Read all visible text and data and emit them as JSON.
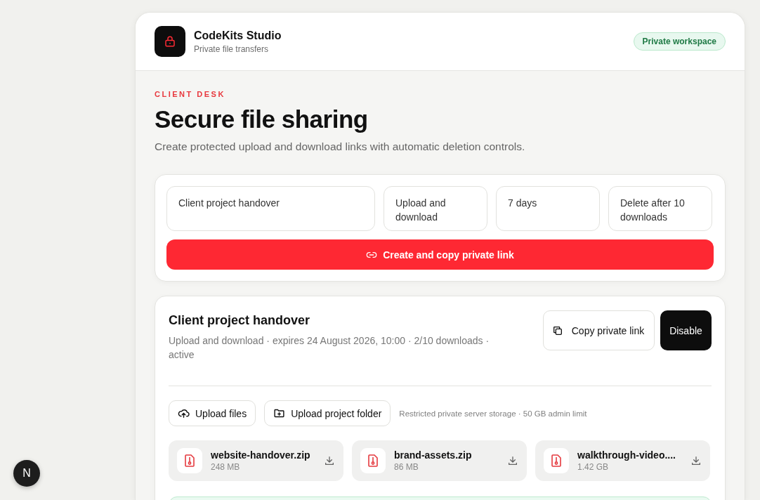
{
  "header": {
    "brand": "CodeKits Studio",
    "subtitle": "Private file transfers",
    "badge": "Private workspace"
  },
  "intro": {
    "eyebrow": "CLIENT DESK",
    "title": "Secure file sharing",
    "description": "Create protected upload and download links with automatic deletion controls."
  },
  "form": {
    "fields": [
      {
        "kind": "text",
        "value": "Client project handover"
      },
      {
        "kind": "select",
        "value": "Upload and download"
      },
      {
        "kind": "select",
        "value": "7 days"
      },
      {
        "kind": "select",
        "value": "Delete after 10 downloads"
      }
    ],
    "submit": "Create and copy private link"
  },
  "session": {
    "title": "Client project handover",
    "meta": "Upload and download · expires 24 August 2026, 10:00 · 2/10 downloads · active",
    "copy_button": "Copy private link",
    "disable_button": "Disable",
    "upload_buttons": [
      {
        "kind": "files",
        "label": "Upload files"
      },
      {
        "kind": "folder",
        "label": "Upload project folder"
      }
    ],
    "storage_note": "Restricted private server storage · 50 GB admin limit",
    "files": [
      {
        "name": "website-handover.zip",
        "size": "248 MB"
      },
      {
        "name": "brand-assets.zip",
        "size": "86 MB"
      },
      {
        "name": "walkthrough-video....",
        "size": "1.42 GB"
      }
    ]
  },
  "dev_badge": "N"
}
